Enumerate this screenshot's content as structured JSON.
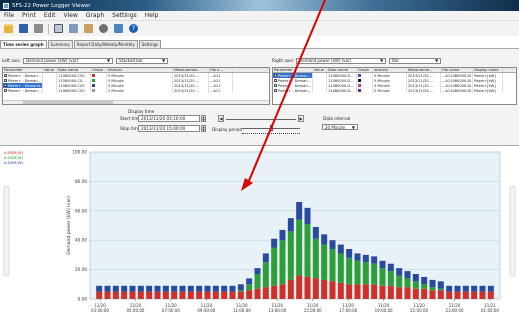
{
  "window": {
    "title": "SFS-22 Power Logger Viewer"
  },
  "menu": [
    "File",
    "Print",
    "Edit",
    "View",
    "Graph",
    "Settings",
    "Help"
  ],
  "toolbar": [
    "open-folder-icon",
    "save-icon",
    "print-icon",
    "print-preview-icon",
    "copy-icon",
    "paste-icon",
    "settings-icon",
    "export-icon",
    "help-icon"
  ],
  "tabs": [
    {
      "label": "Time series graph",
      "active": true
    },
    {
      "label": "Summary",
      "active": false
    },
    {
      "label": "Report Daily/Weekly/Monthly",
      "active": false
    },
    {
      "label": "Settings",
      "active": false
    }
  ],
  "left_axis": {
    "label": "Left axis:",
    "value": "Demand power [kW] (var)",
    "style": "Stacked bar"
  },
  "right_axis": {
    "label": "Right axis:",
    "value": "Demand power [kW] (var)",
    "style": "Bar"
  },
  "left_table": {
    "columns": [
      "Parameter",
      "Value",
      "Data name",
      "Graph",
      "Interval",
      "Measuremen...",
      "File n..."
    ],
    "rows": [
      {
        "param": "Pdem+ : Deman...",
        "value": "",
        "data": "11080000.CSV",
        "color": "#d0302a",
        "interval": "5 Minute",
        "meas": "2013/11/20 ...",
        "file": "...A11",
        "checked": true,
        "selected": false
      },
      {
        "param": "Pdem+ : Deman...",
        "value": "",
        "data": "11080000.CS...",
        "color": "#2e9e3a",
        "interval": "5 Minute",
        "meas": "2013/11/20 ...",
        "file": "...A11",
        "checked": true,
        "selected": false
      },
      {
        "param": "Pdem+ : Demand...",
        "value": "",
        "data": "11080000.CSV",
        "color": "#2a4aa0",
        "interval": "5 Minute",
        "meas": "2013/11/20 ...",
        "file": "...A11",
        "checked": true,
        "selected": true
      },
      {
        "param": "Pdem+ : Deman...",
        "value": "",
        "data": "11080000.CSV",
        "color": "#9a9a9a",
        "interval": "5 Minute",
        "meas": "2013/11/20 ...",
        "file": "...A11",
        "checked": false,
        "selected": false
      }
    ]
  },
  "right_table": {
    "columns": [
      "Parameter",
      "Value",
      "Data name",
      "Graph",
      "Interval",
      "Measureme...",
      "File name",
      "Display name"
    ],
    "rows": [
      {
        "param": "Pdem+ : Deman...",
        "value": "",
        "data": "11080000.D...",
        "color": "#3f5fa8",
        "interval": "5 Minute",
        "meas": "2013/11/20 ...",
        "file": "...A11080000.DI",
        "disp": "Pdem+[kW]",
        "checked": false,
        "selected": true
      },
      {
        "param": "Pdem+ : Deman...",
        "value": "",
        "data": "11080000.D...",
        "color": "#111111",
        "interval": "5 Minute",
        "meas": "2013/11/20 ...",
        "file": "...A11080000.DI",
        "disp": "Pdem+[kW]",
        "checked": false,
        "selected": false
      },
      {
        "param": "Pdem+ : Deman...",
        "value": "",
        "data": "11080000.D...",
        "color": "#d03a8a",
        "interval": "5 Minute",
        "meas": "2013/11/20 ...",
        "file": "...A11080000.DI",
        "disp": "Pdem+[kW]",
        "checked": false,
        "selected": false
      },
      {
        "param": "Pdem+ : Deman...",
        "value": "",
        "data": "11080000.D...",
        "color": "#6a2a9a",
        "interval": "5 Minute",
        "meas": "2013/11/20 ...",
        "file": "...A11080000.DI",
        "disp": "Pdem+[kW]",
        "checked": false,
        "selected": false
      }
    ]
  },
  "display_time": {
    "group_label": "Display time",
    "start_label": "Start time:",
    "start_value": "2013/11/20 05:10:00",
    "stop_label": "Stop time:",
    "stop_value": "2013/11/20 15:00:00",
    "period_label": "Display period",
    "interval_label": "Data interval",
    "interval_value": "20 Minute"
  },
  "chart_data": {
    "type": "bar",
    "stacked": true,
    "ylabel": "Demand power [kW] (var)",
    "ylim": [
      0,
      100
    ],
    "yticks": [
      "0.00",
      "20.00",
      "40.00",
      "60.00",
      "80.00",
      "100.00"
    ],
    "xtick_labels": [
      [
        "11/20",
        "03:00:00"
      ],
      [
        "11/20",
        "05:00:00"
      ],
      [
        "11/20",
        "07:00:00"
      ],
      [
        "11/20",
        "09:00:00"
      ],
      [
        "11/20",
        "11:00:00"
      ],
      [
        "11/20",
        "13:00:00"
      ],
      [
        "11/20",
        "15:00:00"
      ],
      [
        "11/20",
        "17:00:00"
      ],
      [
        "11/20",
        "19:00:00"
      ],
      [
        "11/20",
        "21:00:00"
      ],
      [
        "11/20",
        "23:00:00"
      ],
      [
        "11/21",
        "01:00:00"
      ]
    ],
    "grid": true,
    "legend_position": "top-left",
    "series": [
      {
        "name": "A:DEM(W)",
        "color": "#d0302a",
        "values": [
          5,
          5,
          5,
          5,
          5,
          5,
          5,
          5,
          5,
          5,
          5,
          5,
          5,
          5,
          5,
          5,
          5,
          5,
          6,
          7,
          8,
          9,
          10,
          13,
          16,
          15,
          14,
          13,
          12,
          11,
          10,
          10,
          10,
          10,
          9,
          9,
          8,
          8,
          7,
          7,
          6,
          6,
          5,
          5,
          5,
          5,
          5,
          5
        ]
      },
      {
        "name": "A:DEM(W)",
        "color": "#2e9e3a",
        "values": [
          0,
          0,
          0,
          0,
          0,
          0,
          0,
          0,
          0,
          0,
          0,
          0,
          0,
          0,
          0,
          0,
          0,
          1,
          4,
          10,
          17,
          26,
          30,
          33,
          38,
          36,
          27,
          24,
          22,
          20,
          18,
          16,
          15,
          14,
          12,
          10,
          8,
          6,
          5,
          3,
          2,
          1,
          0,
          0,
          0,
          0,
          0,
          0
        ]
      },
      {
        "name": "A:DEM(W)",
        "color": "#2a4aa0",
        "values": [
          4,
          4,
          4,
          4,
          4,
          4,
          4,
          4,
          4,
          4,
          4,
          4,
          4,
          4,
          4,
          4,
          4,
          4,
          4,
          4,
          6,
          6,
          7,
          9,
          12,
          11,
          8,
          7,
          6,
          6,
          6,
          5,
          5,
          5,
          5,
          5,
          5,
          5,
          5,
          5,
          5,
          5,
          4,
          4,
          4,
          4,
          4,
          4
        ]
      }
    ]
  },
  "chart_legend": [
    "A:DEM(W)",
    "A:DEM(W)",
    "A:DEM(W)"
  ],
  "colors": {
    "title_dark": "#0d2a47",
    "arrow": "#e00000",
    "plot_bg": "#e8f2f6"
  }
}
